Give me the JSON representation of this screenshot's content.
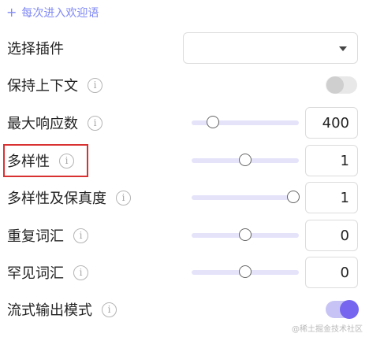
{
  "add_welcome": {
    "icon": "plus-icon",
    "label": "每次进入欢迎语"
  },
  "plugin": {
    "label": "选择插件",
    "value": ""
  },
  "keep_context": {
    "label": "保持上下文",
    "enabled": false
  },
  "max_tokens": {
    "label": "最大响应数",
    "value": "400",
    "slider_fraction": 0.2
  },
  "diversity": {
    "label": "多样性",
    "value": "1",
    "slider_fraction": 0.5
  },
  "diversity_fidelity": {
    "label": "多样性及保真度",
    "value": "1",
    "slider_fraction": 0.95
  },
  "repeat_words": {
    "label": "重复词汇",
    "value": "0",
    "slider_fraction": 0.5
  },
  "rare_words": {
    "label": "罕见词汇",
    "value": "0",
    "slider_fraction": 0.5
  },
  "stream_mode": {
    "label": "流式输出模式",
    "enabled": true
  },
  "info_icon_glyph": "i",
  "watermark": "@稀土掘金技术社区",
  "colors": {
    "accent": "#7565ef",
    "link": "#7f88f5",
    "highlight": "#d93131"
  }
}
